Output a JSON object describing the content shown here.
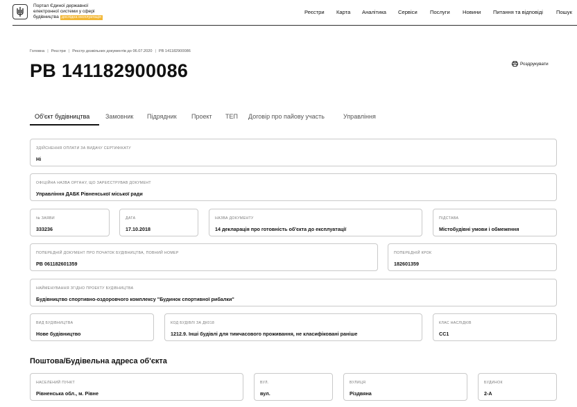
{
  "header": {
    "portal_title_line1": "Портал Єдиної державної",
    "portal_title_line2": "електронної системи у сфері",
    "portal_title_line3": "будівництва",
    "beta_badge": "дослідна експлуатація",
    "nav": [
      "Реєстри",
      "Карта",
      "Аналітика",
      "Сервіси",
      "Послуги",
      "Новини",
      "Питання та відповіді",
      "Пошук"
    ]
  },
  "breadcrumb": [
    "Головна",
    "Реєстри",
    "Реєстр дозвільних документів до 06.07.2020",
    "РВ 141182900086"
  ],
  "page_title": "РВ 141182900086",
  "print_label": "Роздрукувати",
  "tabs": [
    "Об'єкт будівництва",
    "Замовник",
    "Підрядник",
    "Проект",
    "ТЕП",
    "Договір про пайову участь",
    "Управління"
  ],
  "fields": {
    "payment": {
      "label": "Здійснення оплати за видачу сертифікату",
      "value": "Ні"
    },
    "authority": {
      "label": "Офіційна назва органу, що зареєстрував документ",
      "value": "Управління ДАБК Рівненської міської ради"
    },
    "app_no": {
      "label": "№ заяви",
      "value": "333236"
    },
    "date": {
      "label": "Дата",
      "value": "17.10.2018"
    },
    "doc_name": {
      "label": "Назва документу",
      "value": "14 декларація про готовність об'єкта до експлуатації"
    },
    "basis": {
      "label": "Підстава",
      "value": "Містобудівні умови і обмеження"
    },
    "prev_doc": {
      "label": "Попередній документ про початок будівництва, повний номер",
      "value": "РВ 061182601359"
    },
    "prev_step": {
      "label": "Попередній крок",
      "value": "182601359"
    },
    "project_name": {
      "label": "Найменування згідно проекту будівництва",
      "value": "Будівництво спортивно-оздоровчого комплексу \"Будинок спортивної рибалки\""
    },
    "construction_type": {
      "label": "Вид будівництва",
      "value": "Нове будівництво"
    },
    "building_code": {
      "label": "Код будівлі за ДК018",
      "value": "1212.9. Інші будівлі для тимчасового проживання, не класифіковані раніше"
    },
    "consequence_class": {
      "label": "Клас наслідків",
      "value": "СС1"
    }
  },
  "address_section_title": "Поштова/Будівельна адреса об'єкта",
  "address": {
    "locality": {
      "label": "Населений пункт",
      "value": "Рівненська обл., м. Рівне"
    },
    "street_type": {
      "label": "вул.",
      "value": "вул."
    },
    "street": {
      "label": "Вулиця",
      "value": "Різдвяна"
    },
    "building": {
      "label": "Будинок",
      "value": "2-А"
    }
  }
}
